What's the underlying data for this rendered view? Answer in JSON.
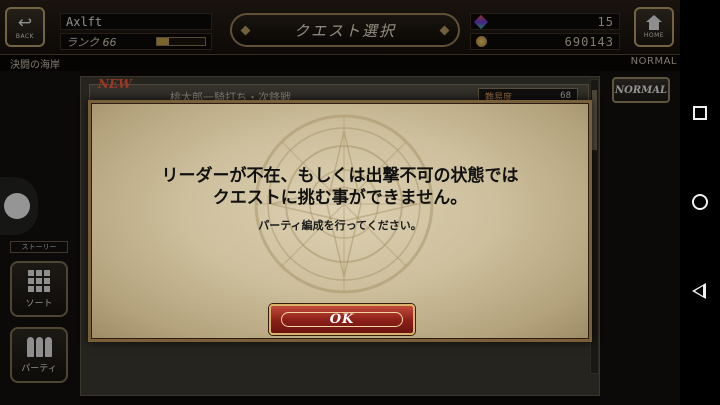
{
  "header": {
    "back_label": "BACK",
    "home_label": "HOME",
    "player_name": "Axlft",
    "rank_label": "ランク 66",
    "rank_progress": 0.25,
    "title": "クエスト選択",
    "gems": "15",
    "coins": "690143"
  },
  "subheader": {
    "location": "決闘の海岸",
    "mode": "NORMAL"
  },
  "sidebar": {
    "story_tag": "ストーリー",
    "sort_label": "ソート",
    "party_label": "パーティ"
  },
  "quest_list": {
    "items": [
      {
        "badge": "NEW",
        "name": "桃太郎一騎打ち・次鋒戦",
        "difficulty_label": "難易度",
        "difficulty_value": "68"
      }
    ]
  },
  "right_panel": {
    "normal_button": "NORMAL"
  },
  "dialog": {
    "line1": "リーダーが不在、もしくは出撃不可の状態では",
    "line2": "クエストに挑む事ができません。",
    "sub": "パーティ編成を行ってください。",
    "ok_label": "OK"
  },
  "colors": {
    "dialog_parchment": "#cdbf9c",
    "ok_button": "#8a1e18",
    "gold_border": "#d8b36a"
  },
  "icons": [
    "back-arrow-icon",
    "home-icon",
    "gem-icon",
    "coin-icon",
    "sort-grid-icon",
    "party-icon",
    "emblem-icon"
  ]
}
